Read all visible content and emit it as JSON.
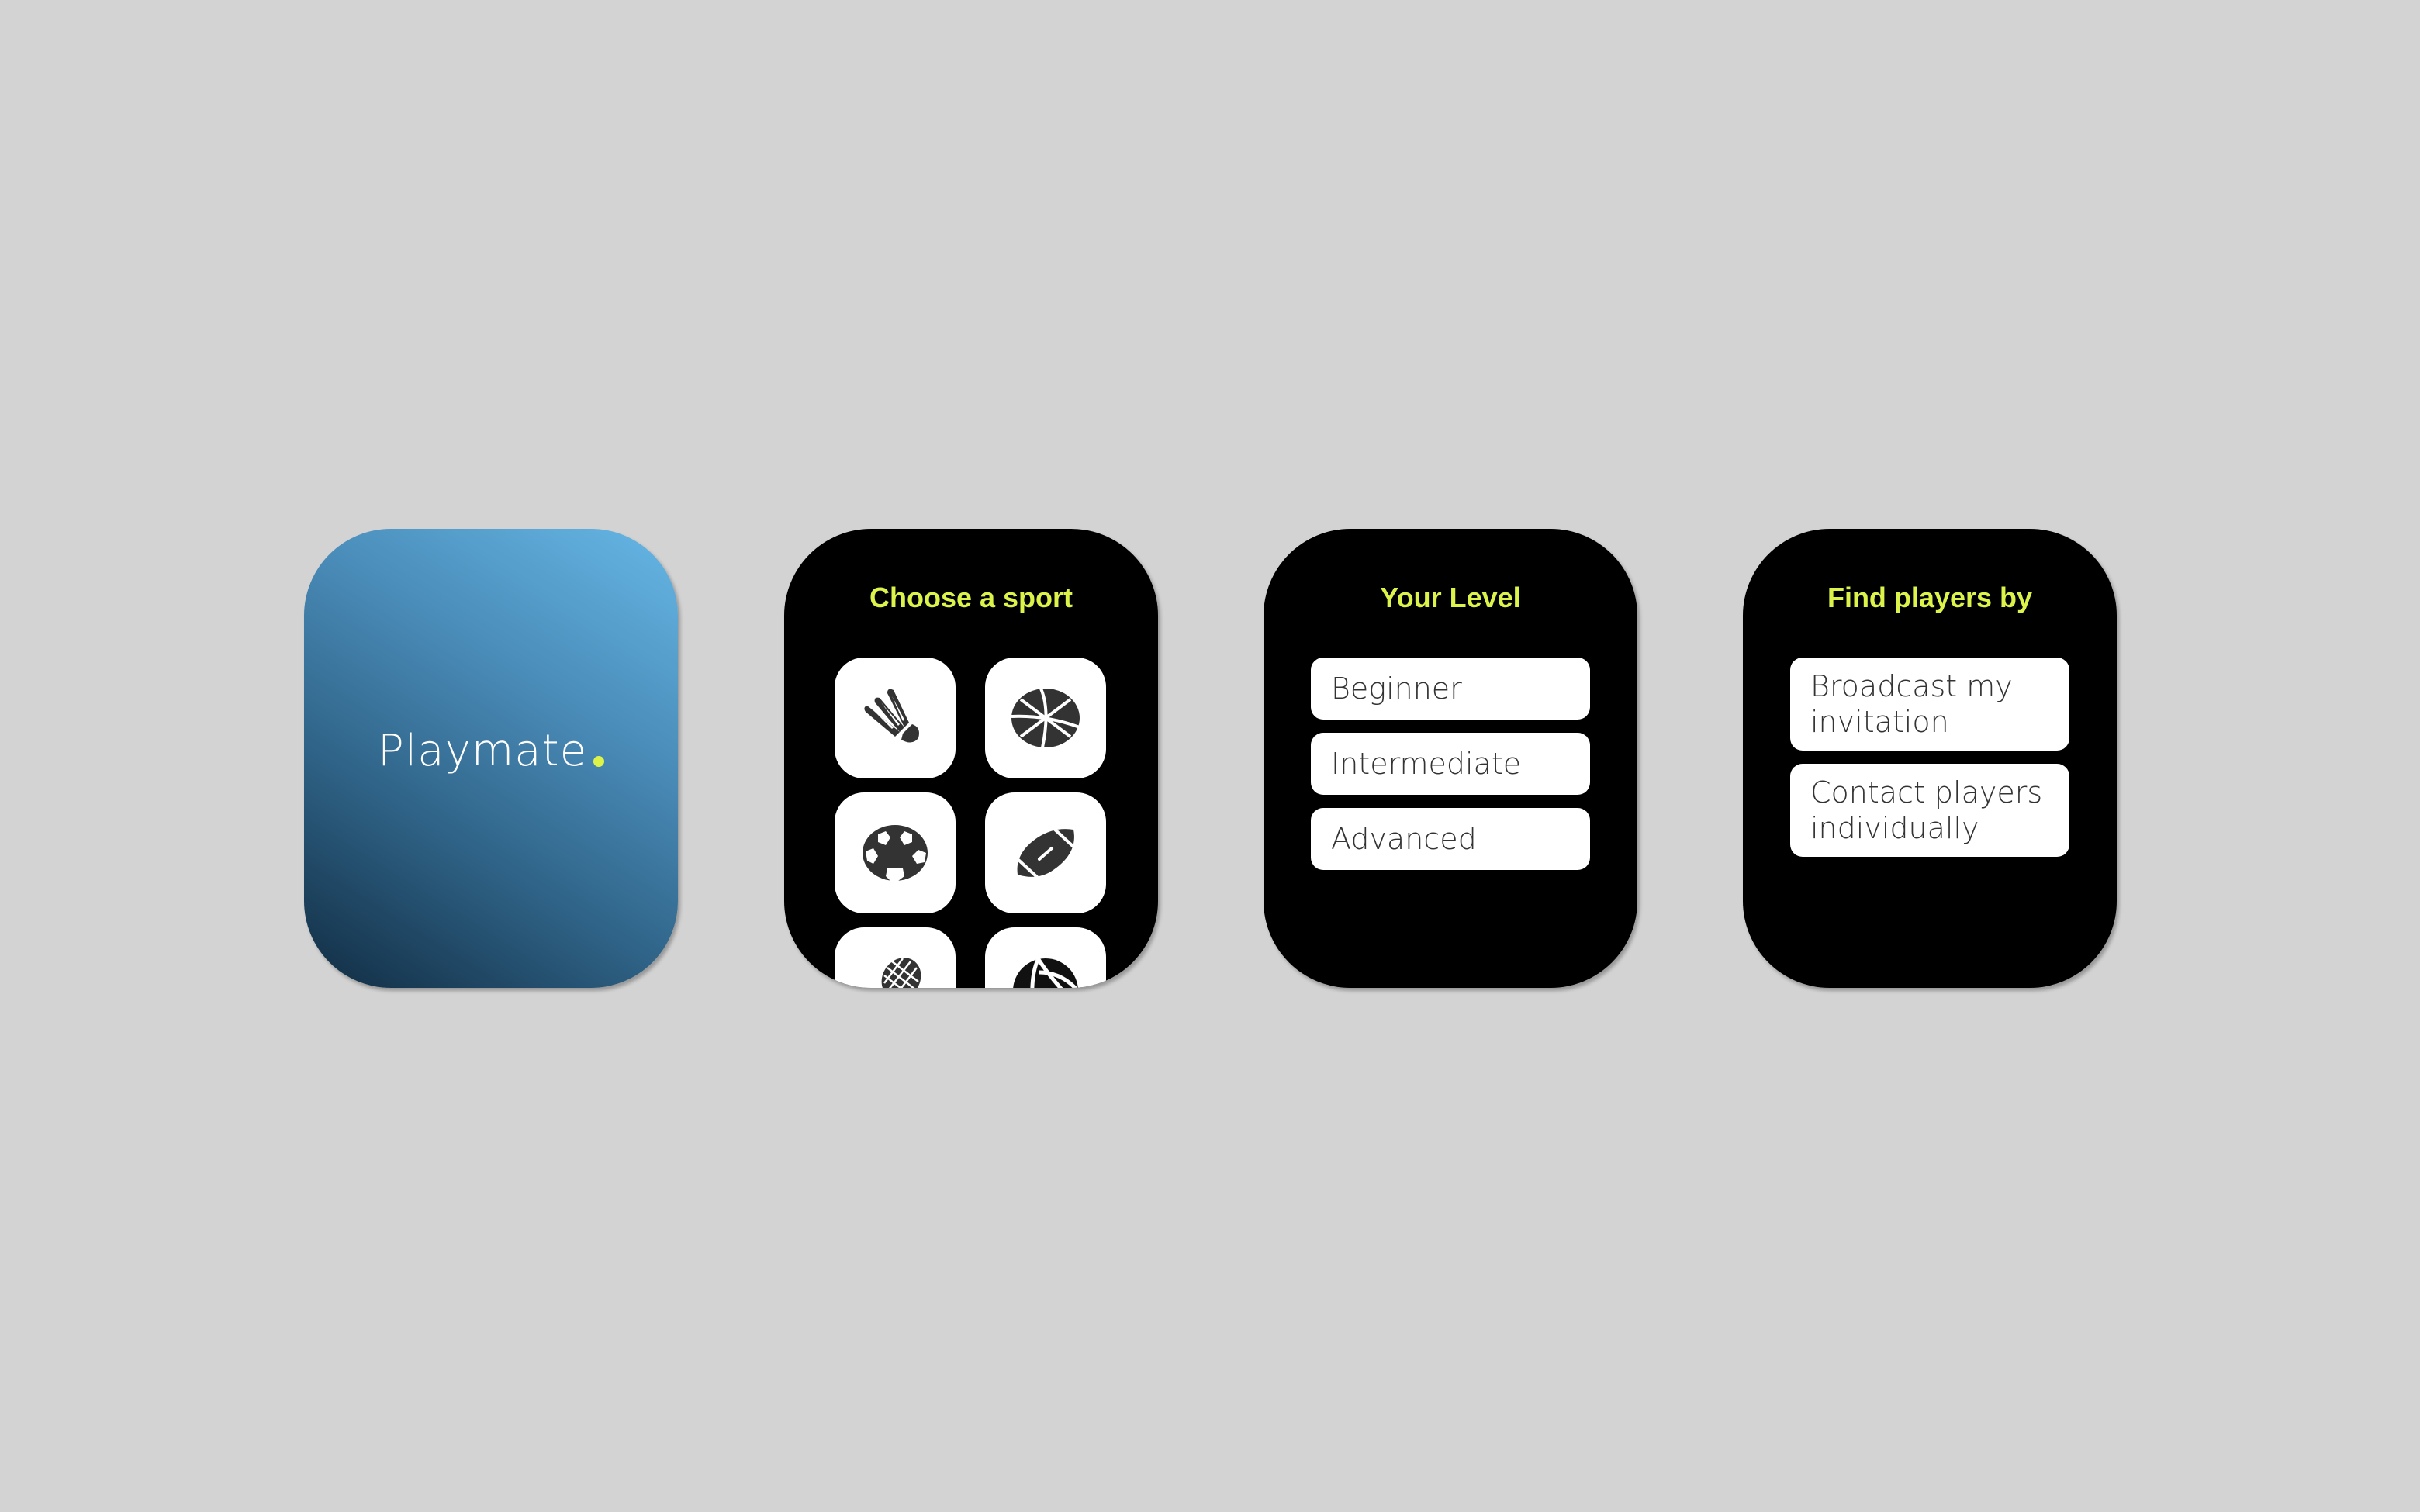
{
  "theme": {
    "accent": "#dcf34a",
    "background": "#d3d3d3",
    "screen_bg": "#000000",
    "icon_color": "#333333"
  },
  "splash": {
    "brand": "Playmate"
  },
  "sport_screen": {
    "title": "Choose a sport",
    "sports": [
      {
        "name": "badminton",
        "icon": "shuttlecock-icon"
      },
      {
        "name": "basketball",
        "icon": "basketball-icon"
      },
      {
        "name": "soccer",
        "icon": "soccer-ball-icon"
      },
      {
        "name": "american-football",
        "icon": "football-icon"
      },
      {
        "name": "tennis",
        "icon": "tennis-racket-icon"
      },
      {
        "name": "volleyball",
        "icon": "volleyball-icon"
      }
    ]
  },
  "level_screen": {
    "title": "Your Level",
    "options": [
      "Beginner",
      "Intermediate",
      "Advanced"
    ]
  },
  "find_screen": {
    "title": "Find players by",
    "options": [
      {
        "line1": "Broadcast my",
        "line2": "invitation"
      },
      {
        "line1": "Contact players",
        "line2": "individually"
      }
    ]
  }
}
